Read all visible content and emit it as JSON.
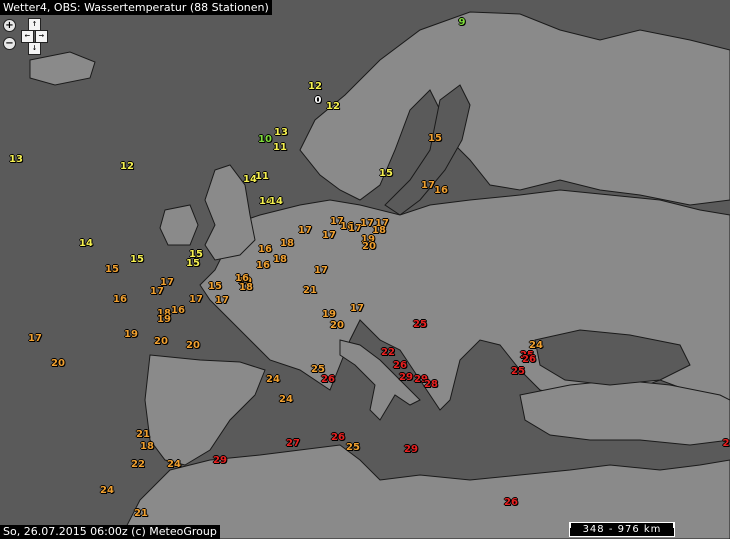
{
  "title": "Wetter4, OBS: Wassertemperatur (88 Stationen)",
  "footer": "So, 26.07.2015 06:00z (c) MeteoGroup",
  "scale_label": "348 - 976 km",
  "controls": {
    "zoom_in": "+",
    "zoom_out": "−",
    "up": "↑",
    "down": "↓",
    "left": "←",
    "right": "→"
  },
  "colors": {
    "sea": "#5a5a5a",
    "land": "#8a8a8a",
    "border": "#1a1a1a",
    "white": "#ffffff",
    "green": "#7fdc3a",
    "yellow": "#f5f050",
    "orange": "#f0a030",
    "red": "#e82020"
  },
  "stations": [
    {
      "v": "9",
      "c": "green"
    },
    {
      "v": "12",
      "c": "yellow"
    },
    {
      "v": "0",
      "c": "white"
    },
    {
      "v": "12",
      "c": "yellow"
    },
    {
      "v": "13",
      "c": "yellow"
    },
    {
      "v": "10",
      "c": "green"
    },
    {
      "v": "11",
      "c": "yellow"
    },
    {
      "v": "15",
      "c": "orange"
    },
    {
      "v": "13",
      "c": "yellow"
    },
    {
      "v": "12",
      "c": "yellow"
    },
    {
      "v": "14",
      "c": "yellow"
    },
    {
      "v": "11",
      "c": "yellow"
    },
    {
      "v": "15",
      "c": "yellow"
    },
    {
      "v": "17",
      "c": "orange"
    },
    {
      "v": "16",
      "c": "orange"
    },
    {
      "v": "14",
      "c": "yellow"
    },
    {
      "v": "14",
      "c": "yellow"
    },
    {
      "v": "17",
      "c": "orange"
    },
    {
      "v": "16",
      "c": "orange"
    },
    {
      "v": "17",
      "c": "orange"
    },
    {
      "v": "17",
      "c": "orange"
    },
    {
      "v": "17",
      "c": "orange"
    },
    {
      "v": "17",
      "c": "orange"
    },
    {
      "v": "17",
      "c": "orange"
    },
    {
      "v": "18",
      "c": "orange"
    },
    {
      "v": "19",
      "c": "orange"
    },
    {
      "v": "20",
      "c": "orange"
    },
    {
      "v": "14",
      "c": "yellow"
    },
    {
      "v": "15",
      "c": "yellow"
    },
    {
      "v": "15",
      "c": "yellow"
    },
    {
      "v": "15",
      "c": "yellow"
    },
    {
      "v": "16",
      "c": "orange"
    },
    {
      "v": "18",
      "c": "orange"
    },
    {
      "v": "16",
      "c": "orange"
    },
    {
      "v": "18",
      "c": "orange"
    },
    {
      "v": "17",
      "c": "orange"
    },
    {
      "v": "15",
      "c": "orange"
    },
    {
      "v": "17",
      "c": "orange"
    },
    {
      "v": "17",
      "c": "orange"
    },
    {
      "v": "16",
      "c": "orange"
    },
    {
      "v": "19",
      "c": "orange"
    },
    {
      "v": "15",
      "c": "orange"
    },
    {
      "v": "21",
      "c": "orange"
    },
    {
      "v": "16",
      "c": "orange"
    },
    {
      "v": "18",
      "c": "orange"
    },
    {
      "v": "16",
      "c": "orange"
    },
    {
      "v": "17",
      "c": "orange"
    },
    {
      "v": "18",
      "c": "orange"
    },
    {
      "v": "17",
      "c": "orange"
    },
    {
      "v": "19",
      "c": "orange"
    },
    {
      "v": "17",
      "c": "orange"
    },
    {
      "v": "19",
      "c": "orange"
    },
    {
      "v": "20",
      "c": "orange"
    },
    {
      "v": "20",
      "c": "orange"
    },
    {
      "v": "17",
      "c": "orange"
    },
    {
      "v": "20",
      "c": "orange"
    },
    {
      "v": "19",
      "c": "orange"
    },
    {
      "v": "20",
      "c": "orange"
    },
    {
      "v": "25",
      "c": "red"
    },
    {
      "v": "22",
      "c": "red"
    },
    {
      "v": "26",
      "c": "red"
    },
    {
      "v": "29",
      "c": "red"
    },
    {
      "v": "29",
      "c": "red"
    },
    {
      "v": "28",
      "c": "red"
    },
    {
      "v": "24",
      "c": "orange"
    },
    {
      "v": "25",
      "c": "red"
    },
    {
      "v": "25",
      "c": "red"
    },
    {
      "v": "26",
      "c": "red"
    },
    {
      "v": "24",
      "c": "orange"
    },
    {
      "v": "25",
      "c": "orange"
    },
    {
      "v": "26",
      "c": "red"
    },
    {
      "v": "24",
      "c": "orange"
    },
    {
      "v": "21",
      "c": "orange"
    },
    {
      "v": "18",
      "c": "orange"
    },
    {
      "v": "22",
      "c": "orange"
    },
    {
      "v": "24",
      "c": "orange"
    },
    {
      "v": "29",
      "c": "red"
    },
    {
      "v": "27",
      "c": "red"
    },
    {
      "v": "26",
      "c": "red"
    },
    {
      "v": "25",
      "c": "orange"
    },
    {
      "v": "29",
      "c": "red"
    },
    {
      "v": "24",
      "c": "orange"
    },
    {
      "v": "21",
      "c": "orange"
    },
    {
      "v": "26",
      "c": "red"
    },
    {
      "v": "2",
      "c": "red"
    }
  ]
}
